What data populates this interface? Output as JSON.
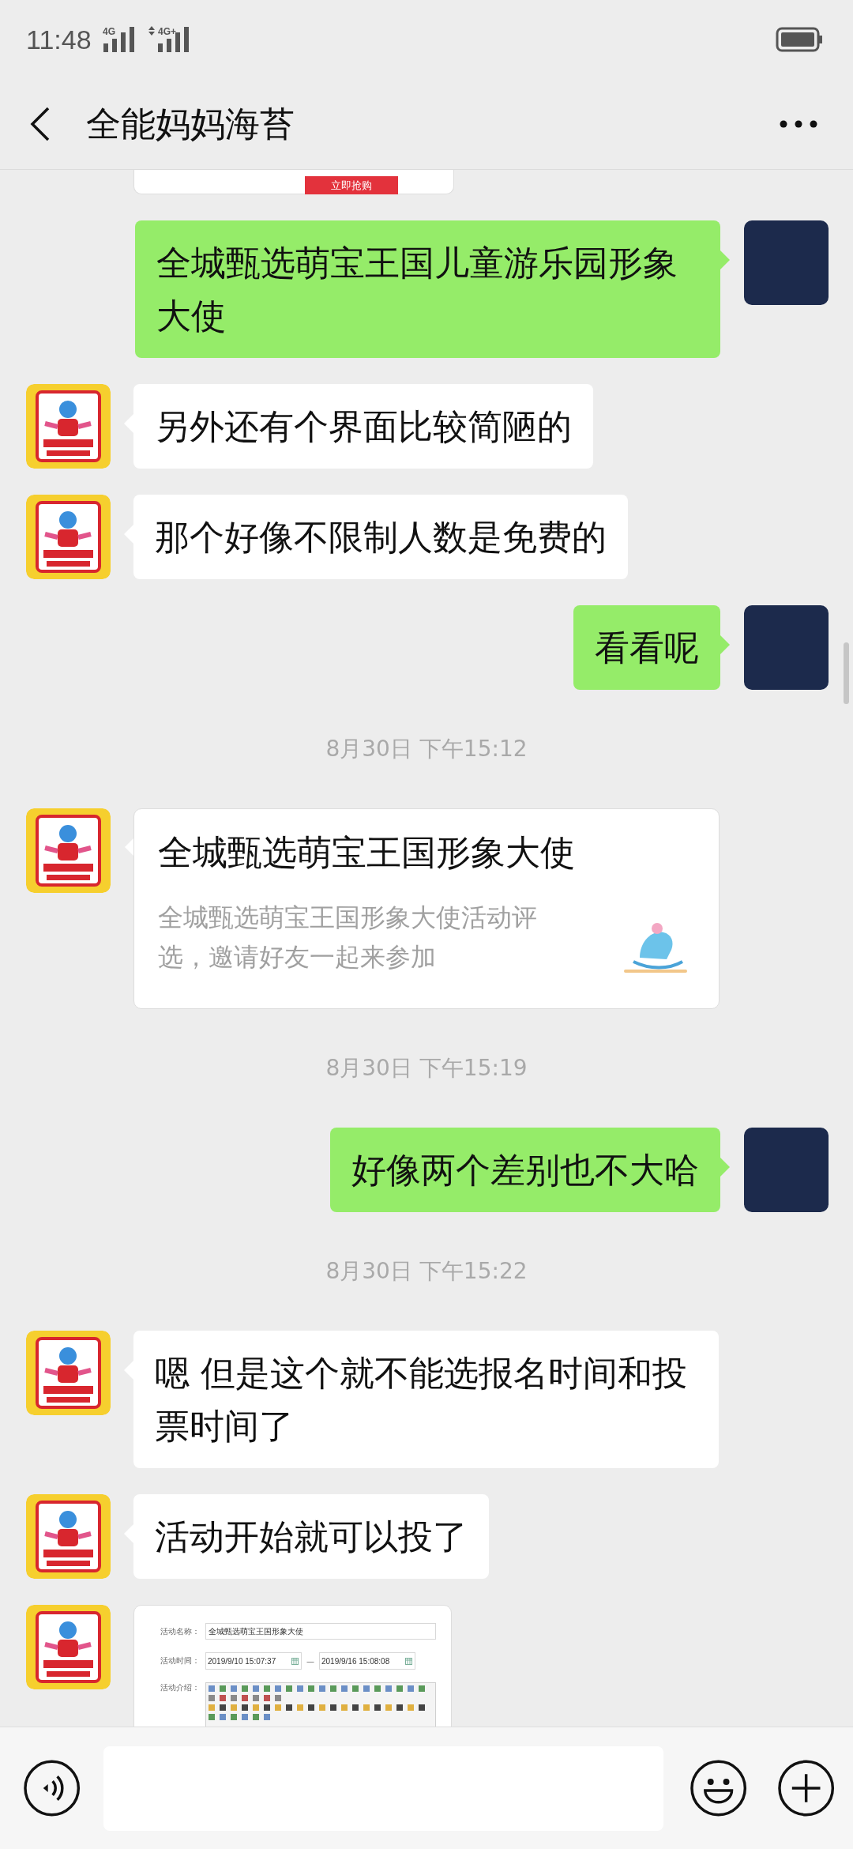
{
  "status_bar": {
    "time": "11:48",
    "networks": [
      "4G",
      "4G+"
    ]
  },
  "header": {
    "title": "全能妈妈海苔"
  },
  "messages": [
    {
      "kind": "cut_card",
      "button": "立即抢购"
    },
    {
      "kind": "text",
      "from_me": true,
      "text": "全城甄选萌宝王国儿童游乐园形象大使"
    },
    {
      "kind": "text",
      "from_me": false,
      "text": "另外还有个界面比较简陋的"
    },
    {
      "kind": "text",
      "from_me": false,
      "text": "那个好像不限制人数是免费的"
    },
    {
      "kind": "text",
      "from_me": true,
      "text": "看看呢"
    },
    {
      "kind": "time",
      "text": "8月30日 下午15:12"
    },
    {
      "kind": "link",
      "from_me": false,
      "title": "全城甄选萌宝王国形象大使",
      "description": "全城甄选萌宝王国形象大使活动评选，邀请好友一起来参加"
    },
    {
      "kind": "time",
      "text": "8月30日 下午15:19"
    },
    {
      "kind": "text",
      "from_me": true,
      "text": "好像两个差别也不大哈"
    },
    {
      "kind": "time",
      "text": "8月30日 下午15:22"
    },
    {
      "kind": "text",
      "from_me": false,
      "text": "嗯 但是这个就不能选报名时间和投票时间了"
    },
    {
      "kind": "text",
      "from_me": false,
      "text": "活动开始就可以投了"
    },
    {
      "kind": "image",
      "from_me": false,
      "form": {
        "name_label": "活动名称：",
        "name_value": "全城甄选萌宝王国形象大使",
        "time_label": "活动时间：",
        "start": "2019/9/10 15:07:37",
        "separator": "—",
        "end": "2019/9/16 15:08:08",
        "intro_label": "活动介绍："
      }
    }
  ]
}
